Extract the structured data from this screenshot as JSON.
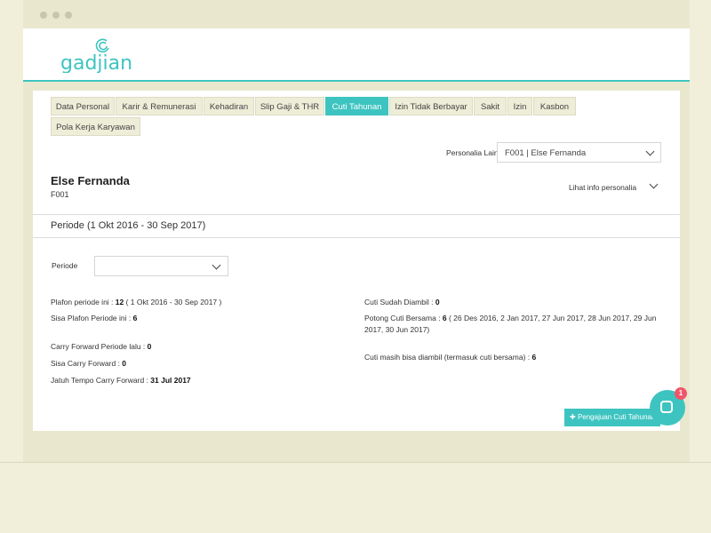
{
  "brand": {
    "logo_text": "gadjian",
    "accent": "#3ec4c0"
  },
  "tabs": [
    {
      "label": "Data Personal"
    },
    {
      "label": "Karir & Remunerasi"
    },
    {
      "label": "Kehadiran"
    },
    {
      "label": "Slip Gaji & THR"
    },
    {
      "label": "Cuti Tahunan",
      "active": true
    },
    {
      "label": "Izin Tidak Berbayar"
    },
    {
      "label": "Sakit"
    },
    {
      "label": "Izin"
    },
    {
      "label": "Kasbon"
    },
    {
      "label": "Pola Kerja Karyawan"
    }
  ],
  "personalia": {
    "label": "Personalia Lain",
    "value": "F001 | Else Fernanda"
  },
  "employee": {
    "name": "Else Fernanda",
    "id": "F001",
    "info_link": "Lihat info personalia"
  },
  "period": {
    "heading": "Periode (1 Okt 2016 - 30 Sep 2017)",
    "select_label": "Periode",
    "select_value": ""
  },
  "left_info": {
    "plafon_label": "Plafon periode ini : ",
    "plafon_value": "12",
    "plafon_suffix": " ( 1 Okt 2016 - 30 Sep 2017 )",
    "sisa_plafon_label": "Sisa Plafon Periode ini : ",
    "sisa_plafon_value": "6",
    "carry_label": "Carry Forward Periode lalu : ",
    "carry_value": "0",
    "sisa_carry_label": "Sisa Carry Forward : ",
    "sisa_carry_value": "0",
    "jatuh_tempo_label": "Jatuh Tempo Carry Forward : ",
    "jatuh_tempo_value": "31 Jul 2017"
  },
  "right_info": {
    "diambil_label": "Cuti Sudah Diambil : ",
    "diambil_value": "0",
    "potong_label": "Potong Cuti Bersama : ",
    "potong_value": "6",
    "potong_dates": " ( 26 Des 2016, 2 Jan 2017, 27 Jun 2017, 28 Jun 2017, 29 Jun 2017, 30 Jun 2017)",
    "masih_label": "Cuti masih bisa diambil (termasuk cuti bersama) : ",
    "masih_value": "6"
  },
  "actions": {
    "add_label": "Pengajuan Cuti Tahunan"
  },
  "chat": {
    "badge": "1"
  }
}
